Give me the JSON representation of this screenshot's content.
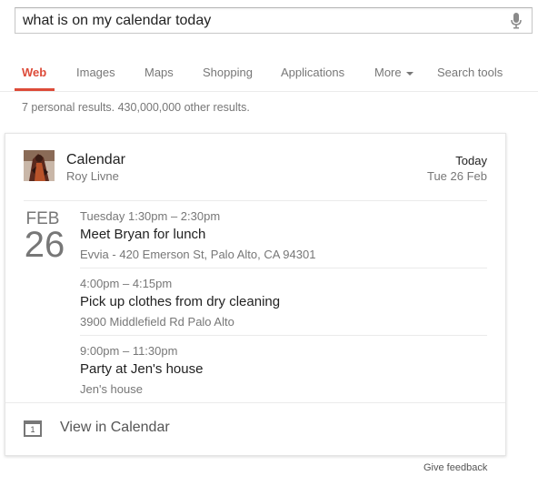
{
  "search": {
    "query": "what is on my calendar today",
    "mic_icon": "microphone-icon"
  },
  "tabs": [
    {
      "label": "Web",
      "active": true
    },
    {
      "label": "Images"
    },
    {
      "label": "Maps"
    },
    {
      "label": "Shopping"
    },
    {
      "label": "Applications"
    },
    {
      "label": "More"
    },
    {
      "label": "Search tools"
    }
  ],
  "result_stats": "7 personal results. 430,000,000 other results.",
  "card": {
    "title": "Calendar",
    "owner": "Roy Livne",
    "today_label": "Today",
    "date_label": "Tue 26 Feb",
    "date_block": {
      "month": "FEB",
      "day": "26"
    },
    "events": [
      {
        "time": "Tuesday 1:30pm – 2:30pm",
        "title": "Meet Bryan for lunch",
        "location": "Evvia - 420 Emerson St, Palo Alto, CA 94301"
      },
      {
        "time": "4:00pm – 4:15pm",
        "title": "Pick up clothes from dry cleaning",
        "location": "3900 Middlefield Rd Palo Alto"
      },
      {
        "time": "9:00pm – 11:30pm",
        "title": "Party at Jen's house",
        "location": "Jen's house"
      }
    ],
    "view_link": "View in Calendar",
    "calendar_icon_number": "1"
  },
  "feedback": "Give feedback",
  "colors": {
    "accent": "#dd4b39",
    "muted": "#777777",
    "text": "#222222"
  }
}
